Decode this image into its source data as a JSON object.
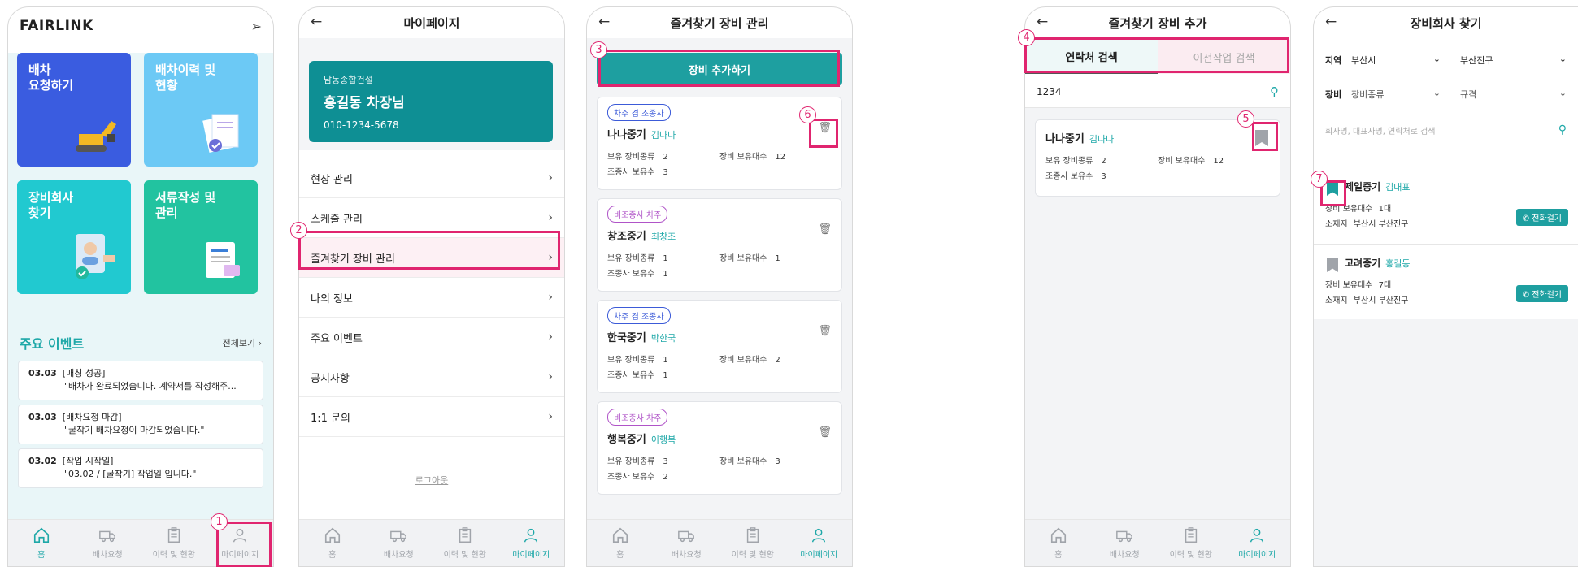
{
  "tabbar": {
    "home": "홈",
    "dispatch": "배차요청",
    "history": "이력 및 현황",
    "mypage": "마이페이지"
  },
  "callouts": [
    "1",
    "2",
    "3",
    "4",
    "5",
    "6",
    "7"
  ],
  "screen1": {
    "logo": "FAIRLINK",
    "tiles": [
      {
        "label": "배차\n요청하기",
        "color": "#3a5ce0"
      },
      {
        "label": "배차이력 및\n현황",
        "color": "#6cc9f5"
      },
      {
        "label": "장비회사\n찾기",
        "color": "#21c9d0"
      },
      {
        "label": "서류작성 및\n관리",
        "color": "#22c3a0"
      }
    ],
    "events_title": "주요 이벤트",
    "events_more": "전체보기",
    "events": [
      {
        "date": "03.03",
        "title": "[매칭 성공]",
        "desc": "\"배차가 완료되었습니다. 계약서를 작성해주..."
      },
      {
        "date": "03.03",
        "title": "[배차요청 마감]",
        "desc": "\"굴착기 배차요청이 마감되었습니다.\""
      },
      {
        "date": "03.02",
        "title": "[작업 시작일]",
        "desc": "\"03.02 / [굴착기] 작업일 입니다.\""
      }
    ]
  },
  "screen2": {
    "title": "마이페이지",
    "company": "남동종합건설",
    "name": "홍길동 차장님",
    "phone": "010-1234-5678",
    "menu": [
      "현장 관리",
      "스케줄 관리",
      "즐겨찾기 장비 관리",
      "나의 정보",
      "주요 이벤트",
      "공지사항",
      "1:1 문의"
    ],
    "logout": "로그아웃"
  },
  "screen3": {
    "title": "즐겨찾기 장비 관리",
    "add_button": "장비 추가하기",
    "cards": [
      {
        "badge": "차주 겸 조종사",
        "badge_type": "blue",
        "name": "나나중기",
        "rep": "김나나",
        "types": "2",
        "count": "12",
        "operators": "3"
      },
      {
        "badge": "비조종사 차주",
        "badge_type": "purple",
        "name": "창조중기",
        "rep": "최창조",
        "types": "1",
        "count": "1",
        "operators": "1"
      },
      {
        "badge": "차주 겸 조종사",
        "badge_type": "blue",
        "name": "한국중기",
        "rep": "박한국",
        "types": "1",
        "count": "2",
        "operators": "1"
      },
      {
        "badge": "비조종사 차주",
        "badge_type": "purple",
        "name": "행복중기",
        "rep": "이행복",
        "types": "3",
        "count": "3",
        "operators": "2"
      }
    ],
    "labels": {
      "types": "보유 장비종류",
      "count": "장비 보유대수",
      "operators": "조종사 보유수"
    }
  },
  "screen4": {
    "title": "즐겨찾기 장비 추가",
    "tab_contact": "연락처 검색",
    "tab_history": "이전작업 검색",
    "search_value": "1234",
    "card": {
      "name": "나나중기",
      "rep": "김나나",
      "types": "2",
      "count": "12",
      "operators": "3"
    }
  },
  "screen5": {
    "title": "장비회사 찾기",
    "region_label": "지역",
    "region1": "부산시",
    "region2": "부산진구",
    "equip_label": "장비",
    "equip1": "장비종류",
    "equip2": "규격",
    "search_placeholder": "회사명, 대표자명, 연락처로 검색",
    "companies": [
      {
        "name": "제일중기",
        "rep": "김대표",
        "count_label": "장비 보유대수",
        "count": "1대",
        "loc_label": "소재지",
        "loc": "부산시 부산진구",
        "call": "전화걸기",
        "bookmarked": true
      },
      {
        "name": "고려중기",
        "rep": "홍길동",
        "count_label": "장비 보유대수",
        "count": "7대",
        "loc_label": "소재지",
        "loc": "부산시 부산진구",
        "call": "전화걸기",
        "bookmarked": false
      }
    ]
  }
}
